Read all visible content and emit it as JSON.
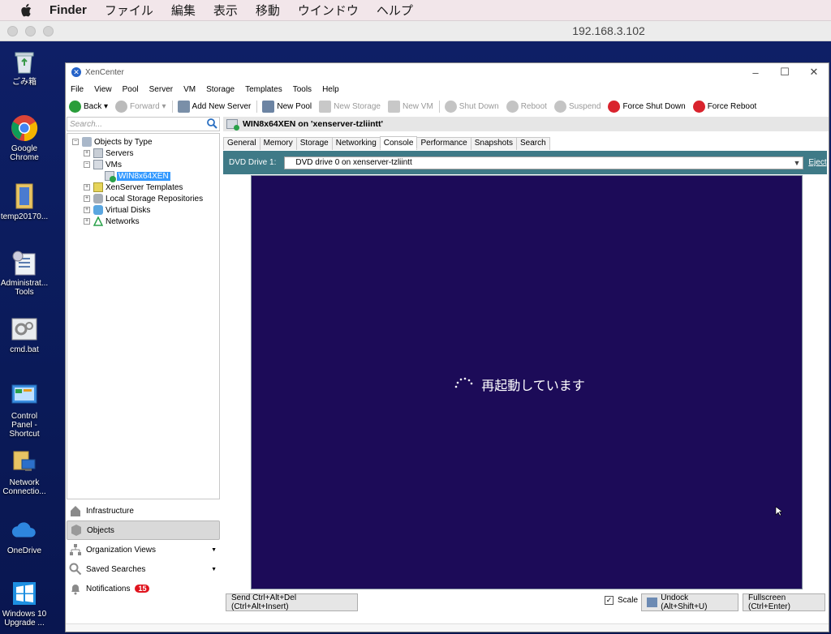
{
  "mac_menu": {
    "app": "Finder",
    "items": [
      "ファイル",
      "編集",
      "表示",
      "移動",
      "ウインドウ",
      "ヘルプ"
    ]
  },
  "remote": {
    "title": "192.168.3.102"
  },
  "desktop_icons": [
    {
      "label": "ごみ箱",
      "icon": "recycle-bin-icon"
    },
    {
      "label": "Google Chrome",
      "icon": "chrome-icon"
    },
    {
      "label": "temp20170...",
      "icon": "folder-icon"
    },
    {
      "label": "Administrat... Tools",
      "icon": "admin-tools-icon"
    },
    {
      "label": "cmd.bat",
      "icon": "gears-icon"
    },
    {
      "label": "Control Panel - Shortcut",
      "icon": "control-panel-icon"
    },
    {
      "label": "Network Connectio...",
      "icon": "network-icon"
    },
    {
      "label": "OneDrive",
      "icon": "cloud-icon"
    },
    {
      "label": "Windows 10 Upgrade ...",
      "icon": "windows-icon"
    }
  ],
  "xc": {
    "title": "XenCenter",
    "menu": [
      "File",
      "View",
      "Pool",
      "Server",
      "VM",
      "Storage",
      "Templates",
      "Tools",
      "Help"
    ],
    "toolbar": {
      "back": "Back",
      "forward": "Forward",
      "add_server": "Add New Server",
      "new_pool": "New Pool",
      "new_storage": "New Storage",
      "new_vm": "New VM",
      "shut_down": "Shut Down",
      "reboot": "Reboot",
      "suspend": "Suspend",
      "force_shut_down": "Force Shut Down",
      "force_reboot": "Force Reboot"
    },
    "search_placeholder": "Search...",
    "tree": {
      "root": "Objects by Type",
      "servers": "Servers",
      "vms": "VMs",
      "vm_selected": "WIN8x64XEN",
      "templates": "XenServer Templates",
      "local_storage": "Local Storage Repositories",
      "virtual_disks": "Virtual Disks",
      "networks": "Networks"
    },
    "nav": {
      "infrastructure": "Infrastructure",
      "objects": "Objects",
      "org_views": "Organization Views",
      "saved_searches": "Saved Searches",
      "notifications": "Notifications",
      "notif_count": "15"
    },
    "object_header": "WIN8x64XEN on 'xenserver-tzliintt'",
    "tabs": [
      "General",
      "Memory",
      "Storage",
      "Networking",
      "Console",
      "Performance",
      "Snapshots",
      "Search"
    ],
    "dvd": {
      "label": "DVD Drive 1:",
      "value": "DVD drive 0 on xenserver-tzliintt",
      "eject": "Eject"
    },
    "console_message": "再起動しています",
    "bottom": {
      "send_cad": "Send Ctrl+Alt+Del (Ctrl+Alt+Insert)",
      "scale": "Scale",
      "undock": "Undock (Alt+Shift+U)",
      "fullscreen": "Fullscreen (Ctrl+Enter)"
    }
  }
}
